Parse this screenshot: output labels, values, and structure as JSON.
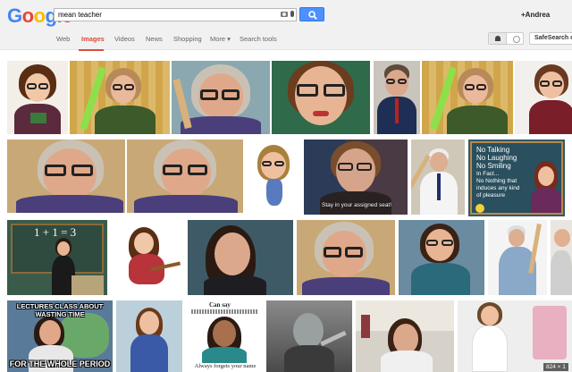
{
  "logo": {
    "letters": [
      "G",
      "o",
      "o",
      "g",
      "l",
      "e"
    ],
    "colors": [
      "#4285f4",
      "#ea4335",
      "#fbbc05",
      "#4285f4",
      "#34a853",
      "#ea4335"
    ]
  },
  "search": {
    "query": "mean teacher"
  },
  "user": {
    "name": "+Andrea"
  },
  "nav": {
    "items": [
      "Web",
      "Images",
      "Videos",
      "News",
      "Shopping",
      "More ▾",
      "Search tools"
    ],
    "active": "Images"
  },
  "safesearch": {
    "label": "SafeSearch o"
  },
  "images": {
    "captions": {
      "assigned_seat": "Stay in your assigned seat!",
      "board_eq": "1 + 1 = 3",
      "sign_lines": [
        "No Talking",
        "No Laughing",
        "No Smiling",
        "In Fact...",
        "No Nothing that",
        "induces any kind",
        "of  pleasure"
      ],
      "meme_top": "LECTURES CLASS ABOUT WASTING TIME",
      "meme_bottom": "FOR THE WHOLE PERIOD",
      "can_say": "Can say",
      "forgets_name": "Always forgets your name",
      "dimensions": "824 × 1"
    }
  },
  "colors": {
    "accent_red": "#dd4b39",
    "search_blue": "#4d90fe"
  }
}
